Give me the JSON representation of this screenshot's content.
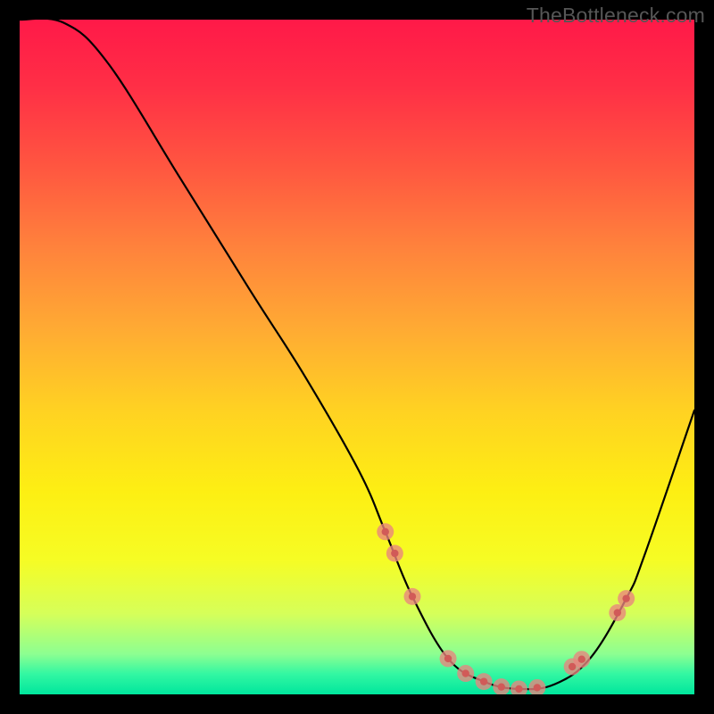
{
  "watermark": "TheBottleneck.com",
  "chart_data": {
    "type": "line",
    "title": "",
    "xlabel": "",
    "ylabel": "",
    "xlim": [
      0,
      100
    ],
    "ylim": [
      0,
      100
    ],
    "series": [
      {
        "name": "bottleneck-curve",
        "x": [
          0,
          6.6,
          13.2,
          23.8,
          34.4,
          42.3,
          50.3,
          54.2,
          58.2,
          63.5,
          68.8,
          74.0,
          79.3,
          84.6,
          89.9,
          92.6,
          100
        ],
        "values": [
          100,
          99.5,
          93.4,
          76.5,
          59.5,
          47.1,
          33.1,
          24.1,
          14.5,
          5.3,
          1.9,
          0.8,
          1.5,
          5.4,
          14.2,
          20.6,
          42.1
        ]
      }
    ],
    "markers": {
      "name": "highlight-points",
      "x": [
        54.2,
        55.6,
        58.2,
        63.5,
        66.1,
        68.8,
        71.4,
        74.0,
        76.7,
        81.9,
        83.3,
        88.6,
        89.9
      ],
      "values": [
        24.1,
        20.9,
        14.5,
        5.3,
        3.1,
        1.9,
        1.1,
        0.8,
        1.0,
        4.1,
        5.2,
        12.1,
        14.2
      ]
    },
    "background_gradient": {
      "top": "#ff1948",
      "bottom": "#00e69d"
    }
  }
}
